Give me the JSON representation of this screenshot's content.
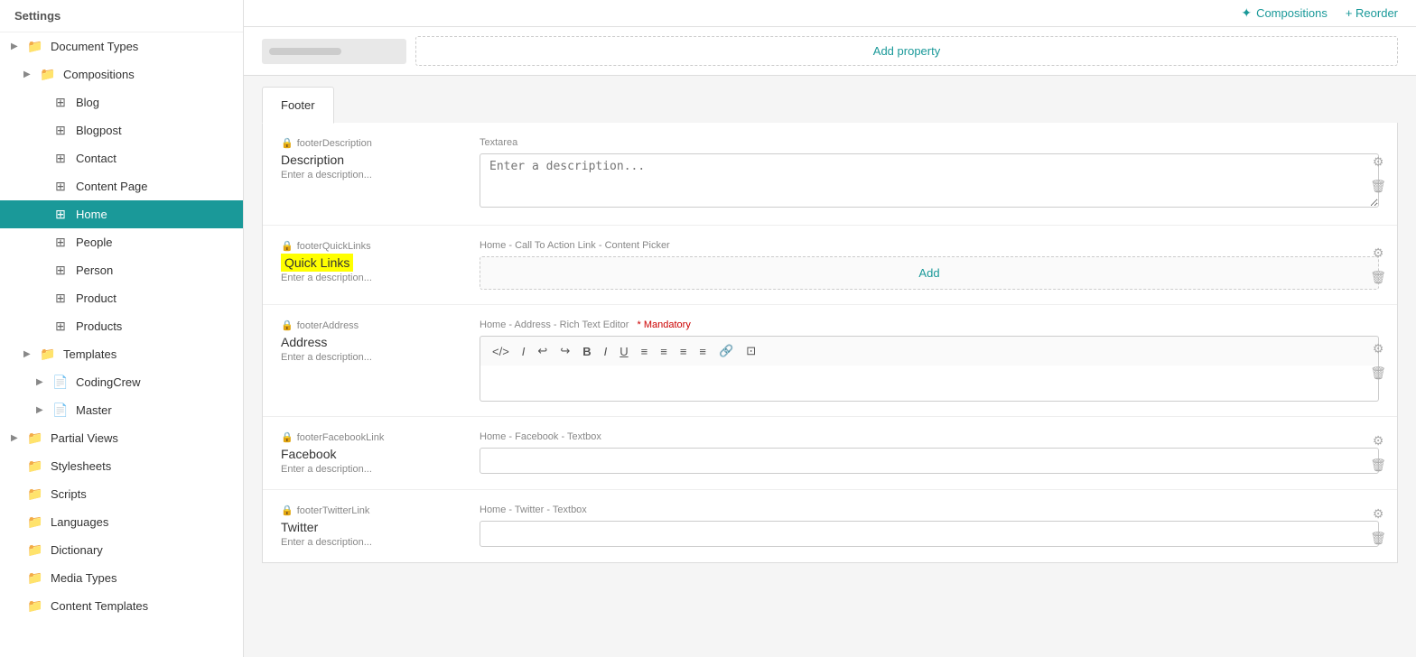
{
  "app": {
    "title": "Settings"
  },
  "topbar": {
    "compositions_label": "Compositions",
    "reorder_label": "+ Reorder"
  },
  "sidebar": {
    "header": "Settings",
    "items": [
      {
        "id": "document-types",
        "label": "Document Types",
        "indent": 0,
        "type": "folder",
        "arrow": "▶"
      },
      {
        "id": "compositions",
        "label": "Compositions",
        "indent": 1,
        "type": "folder",
        "arrow": "▶"
      },
      {
        "id": "blog",
        "label": "Blog",
        "indent": 2,
        "type": "grid",
        "arrow": ""
      },
      {
        "id": "blogpost",
        "label": "Blogpost",
        "indent": 2,
        "type": "grid",
        "arrow": ""
      },
      {
        "id": "contact",
        "label": "Contact",
        "indent": 2,
        "type": "grid",
        "arrow": ""
      },
      {
        "id": "content-page",
        "label": "Content Page",
        "indent": 2,
        "type": "grid",
        "arrow": ""
      },
      {
        "id": "home",
        "label": "Home",
        "indent": 2,
        "type": "grid",
        "arrow": "",
        "active": true
      },
      {
        "id": "people",
        "label": "People",
        "indent": 2,
        "type": "grid",
        "arrow": ""
      },
      {
        "id": "person",
        "label": "Person",
        "indent": 2,
        "type": "grid",
        "arrow": ""
      },
      {
        "id": "product",
        "label": "Product",
        "indent": 2,
        "type": "grid",
        "arrow": ""
      },
      {
        "id": "products",
        "label": "Products",
        "indent": 2,
        "type": "grid",
        "arrow": ""
      },
      {
        "id": "templates",
        "label": "Templates",
        "indent": 1,
        "type": "folder",
        "arrow": "▶"
      },
      {
        "id": "coding-crew",
        "label": "CodingCrew",
        "indent": 2,
        "type": "doc",
        "arrow": "▶"
      },
      {
        "id": "master",
        "label": "Master",
        "indent": 2,
        "type": "doc",
        "arrow": "▶"
      },
      {
        "id": "partial-views",
        "label": "Partial Views",
        "indent": 0,
        "type": "folder",
        "arrow": "▶"
      },
      {
        "id": "stylesheets",
        "label": "Stylesheets",
        "indent": 0,
        "type": "folder",
        "arrow": ""
      },
      {
        "id": "scripts",
        "label": "Scripts",
        "indent": 0,
        "type": "folder",
        "arrow": ""
      },
      {
        "id": "languages",
        "label": "Languages",
        "indent": 0,
        "type": "folder",
        "arrow": ""
      },
      {
        "id": "dictionary",
        "label": "Dictionary",
        "indent": 0,
        "type": "folder",
        "arrow": ""
      },
      {
        "id": "media-types",
        "label": "Media Types",
        "indent": 0,
        "type": "folder",
        "arrow": ""
      },
      {
        "id": "content-templates",
        "label": "Content Templates",
        "indent": 0,
        "type": "folder",
        "arrow": ""
      }
    ]
  },
  "main": {
    "tab": "Footer",
    "properties": [
      {
        "id": "description",
        "alias": "footerDescription",
        "name": "Description",
        "description": "Enter a description...",
        "type_label": "Textarea",
        "highlighted": false,
        "input_type": "textarea",
        "placeholder": "Enter a description...",
        "mandatory": false
      },
      {
        "id": "quick-links",
        "alias": "footerQuickLinks",
        "name": "Quick Links",
        "description": "Enter a description...",
        "type_label": "Home - Call To Action Link - Content Picker",
        "highlighted": true,
        "input_type": "add-btn",
        "add_label": "Add",
        "mandatory": false
      },
      {
        "id": "address",
        "alias": "footerAddress",
        "name": "Address",
        "description": "Enter a description...",
        "type_label": "Home - Address - Rich Text Editor",
        "highlighted": false,
        "input_type": "rte",
        "mandatory": true,
        "mandatory_label": "* Mandatory"
      },
      {
        "id": "facebook",
        "alias": "footerFacebookLink",
        "name": "Facebook",
        "description": "Enter a description...",
        "type_label": "Home - Facebook - Textbox",
        "highlighted": false,
        "input_type": "text",
        "placeholder": ""
      },
      {
        "id": "twitter",
        "alias": "footerTwitterLink",
        "name": "Twitter",
        "description": "Enter a description...",
        "type_label": "Home - Twitter - Textbox",
        "highlighted": false,
        "input_type": "text",
        "placeholder": ""
      }
    ],
    "rte_buttons": [
      "</>",
      "I",
      "↩",
      "↪",
      "B",
      "I",
      "U",
      "≡",
      "≡",
      "≡",
      "≡",
      "🔗",
      "⊡"
    ]
  },
  "colors": {
    "active_bg": "#1a9999",
    "accent": "#1a9999",
    "highlight": "#ffff00"
  }
}
